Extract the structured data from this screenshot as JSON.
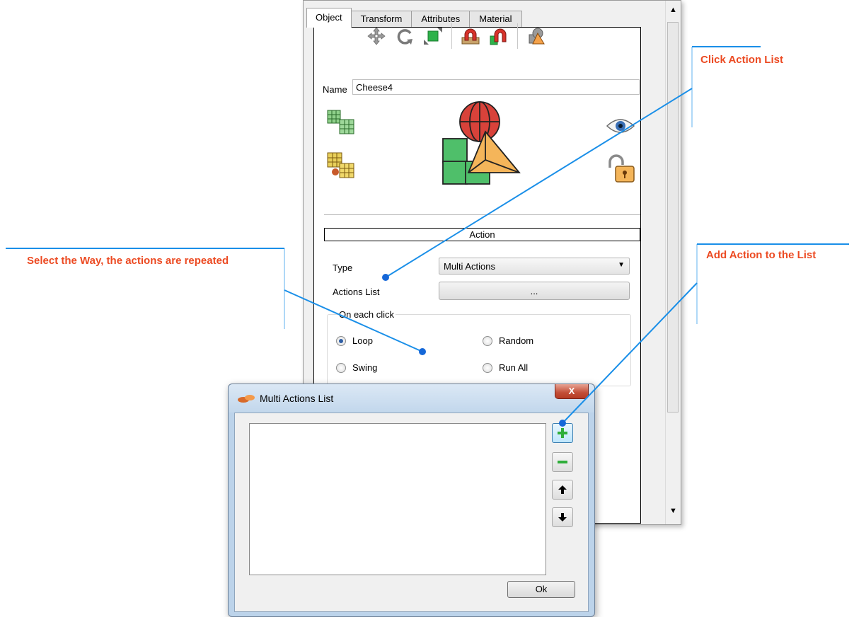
{
  "panel": {
    "tabs": [
      "Object",
      "Transform",
      "Attributes",
      "Material"
    ],
    "name_label": "Name",
    "name_value": "Cheese4",
    "section_title": "Action",
    "type_label": "Type",
    "type_value": "Multi Actions",
    "actions_list_label": "Actions List",
    "actions_list_button": "...",
    "group_title": "On each click",
    "radios": {
      "loop": "Loop",
      "random": "Random",
      "swing": "Swing",
      "run_all": "Run All"
    },
    "selected_radio": "Loop",
    "toolbar_icons": [
      "move-icon",
      "rotate-icon",
      "scale-icon",
      "magnet-icon",
      "magnet-green-icon",
      "pivot-icon"
    ]
  },
  "dialog": {
    "title": "Multi Actions List",
    "close_label": "X",
    "ok_label": "Ok",
    "items": []
  },
  "callouts": {
    "click_action_list": "Click Action List",
    "select_way": "Select the Way, the actions are repeated",
    "add_action": "Add Action to the List"
  },
  "colors": {
    "callout_text": "#ec4a22",
    "callout_line": "#1a8fe8",
    "dialog_frame": "#bcd3ea"
  }
}
